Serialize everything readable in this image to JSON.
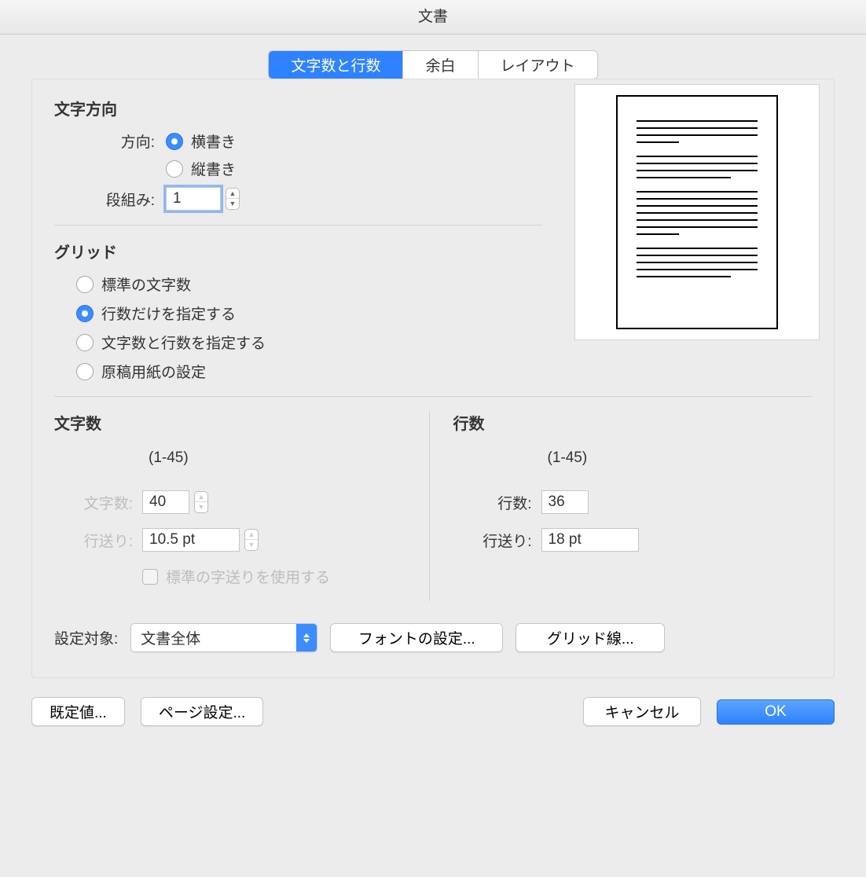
{
  "window": {
    "title": "文書"
  },
  "tabs": {
    "chars_lines": "文字数と行数",
    "margins": "余白",
    "layout": "レイアウト"
  },
  "text_direction": {
    "heading": "文字方向",
    "direction_label": "方向:",
    "horizontal": "横書き",
    "vertical": "縦書き",
    "columns_label": "段組み:",
    "columns_value": "1"
  },
  "grid": {
    "heading": "グリッド",
    "opt_default_chars": "標準の文字数",
    "opt_lines_only": "行数だけを指定する",
    "opt_chars_and_lines": "文字数と行数を指定する",
    "opt_manuscript": "原稿用紙の設定"
  },
  "chars": {
    "heading": "文字数",
    "range": "(1-45)",
    "chars_label": "文字数:",
    "chars_value": "40",
    "pitch_label": "行送り:",
    "pitch_value": "10.5 pt",
    "use_default_pitch": "標準の字送りを使用する"
  },
  "lines": {
    "heading": "行数",
    "range": "(1-45)",
    "lines_label": "行数:",
    "lines_value": "36",
    "pitch_label": "行送り:",
    "pitch_value": "18 pt"
  },
  "apply": {
    "label": "設定対象:",
    "value": "文書全体",
    "font_button": "フォントの設定...",
    "grid_button": "グリッド線..."
  },
  "footer": {
    "defaults": "既定値...",
    "page_setup": "ページ設定...",
    "cancel": "キャンセル",
    "ok": "OK"
  }
}
